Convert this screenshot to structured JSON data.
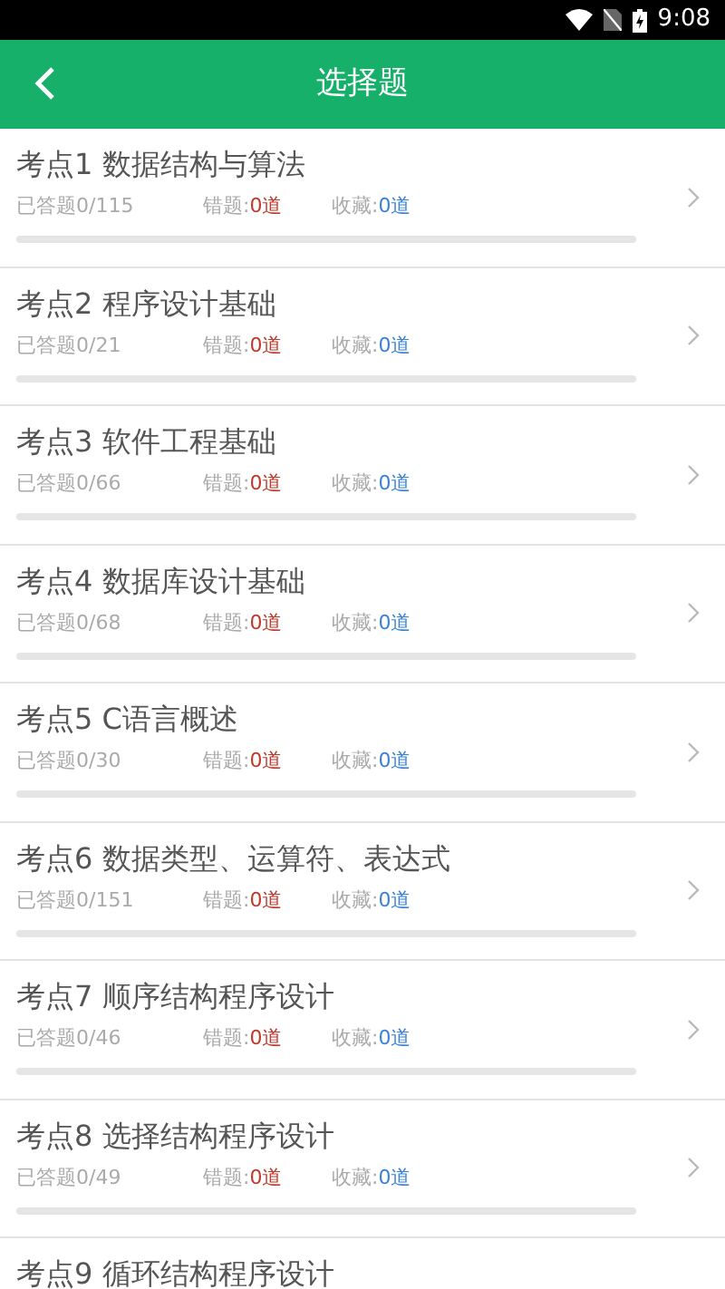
{
  "status_bar": {
    "time": "9:08"
  },
  "header": {
    "title": "选择题"
  },
  "topics": [
    {
      "title": "考点1 数据结构与算法",
      "answered": "已答题0/115",
      "wrong_label": "错题:",
      "wrong": "0道",
      "fav_label": "收藏:",
      "fav": "0道",
      "level": 0
    },
    {
      "title": "考点2 程序设计基础",
      "answered": "已答题0/21",
      "wrong_label": "错题:",
      "wrong": "0道",
      "fav_label": "收藏:",
      "fav": "0道",
      "level": 0
    },
    {
      "title": "考点3 软件工程基础",
      "answered": "已答题0/66",
      "wrong_label": "错题:",
      "wrong": "0道",
      "fav_label": "收藏:",
      "fav": "0道",
      "level": 0
    },
    {
      "title": "考点4 数据库设计基础",
      "answered": "已答题0/68",
      "wrong_label": "错题:",
      "wrong": "0道",
      "fav_label": "收藏:",
      "fav": "0道",
      "level": 0
    },
    {
      "title": "考点5 C语言概述",
      "answered": "已答题0/30",
      "wrong_label": "错题:",
      "wrong": "0道",
      "fav_label": "收藏:",
      "fav": "0道",
      "level": 0
    },
    {
      "title": "考点6 数据类型、运算符、表达式",
      "answered": "已答题0/151",
      "wrong_label": "错题:",
      "wrong": "0道",
      "fav_label": "收藏:",
      "fav": "0道",
      "level": 0
    },
    {
      "title": "考点7 顺序结构程序设计",
      "answered": "已答题0/46",
      "wrong_label": "错题:",
      "wrong": "0道",
      "fav_label": "收藏:",
      "fav": "0道",
      "level": 0
    },
    {
      "title": "考点8 选择结构程序设计",
      "answered": "已答题0/49",
      "wrong_label": "错题:",
      "wrong": "0道",
      "fav_label": "收藏:",
      "fav": "0道",
      "level": 0
    },
    {
      "title": "考点9 循环结构程序设计"
    }
  ]
}
